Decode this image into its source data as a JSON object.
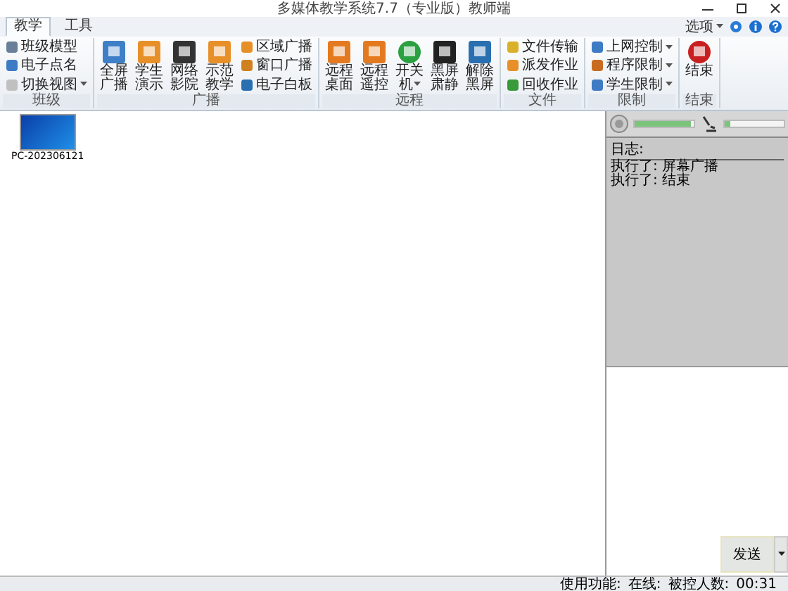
{
  "window": {
    "title": "多媒体教学系统7.7（专业版）教师端"
  },
  "tabs": [
    {
      "label": "教学",
      "selected": true
    },
    {
      "label": "工具",
      "selected": false
    }
  ],
  "options": {
    "label": "选项",
    "dropdown": true
  },
  "ribbon": [
    {
      "label": "班级",
      "items": [
        {
          "label": "班级模型",
          "kind": "small",
          "dropdown": false
        },
        {
          "label": "电子点名",
          "kind": "small",
          "dropdown": false
        },
        {
          "label": "切换视图",
          "kind": "small",
          "dropdown": true
        }
      ]
    },
    {
      "label": "广播",
      "items": [
        {
          "label": "全屏广播",
          "kind": "big",
          "dropdown": false
        },
        {
          "label": "学生演示",
          "kind": "big",
          "dropdown": false
        },
        {
          "label": "网络影院",
          "kind": "big",
          "dropdown": false
        },
        {
          "label": "示范教学",
          "kind": "big",
          "dropdown": false
        },
        {
          "label": "区域广播",
          "kind": "small",
          "dropdown": false
        },
        {
          "label": "窗口广播",
          "kind": "small",
          "dropdown": false
        },
        {
          "label": "电子白板",
          "kind": "small",
          "dropdown": false
        }
      ]
    },
    {
      "label": "远程",
      "items": [
        {
          "label": "远程桌面",
          "kind": "big",
          "dropdown": false
        },
        {
          "label": "远程遥控",
          "kind": "big",
          "dropdown": false
        },
        {
          "label": "开关机",
          "kind": "big",
          "dropdown": true
        },
        {
          "label": "黑屏肃静",
          "kind": "big",
          "dropdown": false
        },
        {
          "label": "解除黑屏",
          "kind": "big",
          "dropdown": false
        }
      ]
    },
    {
      "label": "文件",
      "items": [
        {
          "label": "文件传输",
          "kind": "small",
          "dropdown": false
        },
        {
          "label": "派发作业",
          "kind": "small",
          "dropdown": false
        },
        {
          "label": "回收作业",
          "kind": "small",
          "dropdown": false
        }
      ]
    },
    {
      "label": "限制",
      "items": [
        {
          "label": "上网控制",
          "kind": "small",
          "dropdown": true
        },
        {
          "label": "程序限制",
          "kind": "small",
          "dropdown": true
        },
        {
          "label": "学生限制",
          "kind": "small",
          "dropdown": true
        }
      ]
    },
    {
      "label": "结束",
      "items": [
        {
          "label": "结束",
          "kind": "big",
          "dropdown": false
        }
      ]
    }
  ],
  "computers": [
    {
      "name": "PC-202306121"
    }
  ],
  "audio": {
    "speaker": {
      "level": 0.95
    },
    "microphone": {
      "level": 0.1
    }
  },
  "log": {
    "title": "日志:",
    "lines": [
      "执行了: 屏幕广播",
      "执行了: 结束"
    ]
  },
  "send_button": "发送",
  "status_bar": [
    "使用功能:",
    "在线:",
    "被控人数:",
    "00:31"
  ]
}
